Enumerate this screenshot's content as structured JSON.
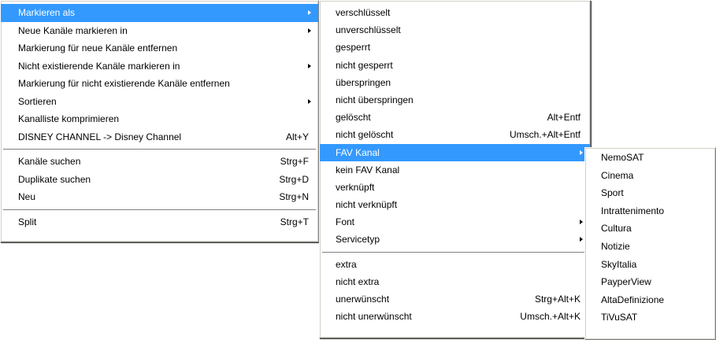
{
  "menu1": {
    "items": [
      {
        "label": "Markieren als",
        "shortcut": "",
        "submenu": true,
        "highlighted": true
      },
      {
        "label": "Neue Kanäle markieren in",
        "shortcut": "",
        "submenu": true
      },
      {
        "label": "Markierung für neue Kanäle entfernen",
        "shortcut": ""
      },
      {
        "label": "Nicht existierende Kanäle markieren in",
        "shortcut": "",
        "submenu": true
      },
      {
        "label": "Markierung für nicht existierende Kanäle entfernen",
        "shortcut": ""
      },
      {
        "label": "Sortieren",
        "shortcut": "",
        "submenu": true
      },
      {
        "label": "Kanalliste komprimieren",
        "shortcut": ""
      },
      {
        "label": "DISNEY CHANNEL -> Disney Channel",
        "shortcut": "Alt+Y"
      },
      {
        "separator": true
      },
      {
        "label": "Kanäle suchen",
        "shortcut": "Strg+F"
      },
      {
        "label": "Duplikate suchen",
        "shortcut": "Strg+D"
      },
      {
        "label": "Neu",
        "shortcut": "Strg+N"
      },
      {
        "separator": true
      },
      {
        "label": "Split",
        "shortcut": "Strg+T"
      }
    ]
  },
  "menu2": {
    "items": [
      {
        "label": "verschlüsselt",
        "shortcut": ""
      },
      {
        "label": "unverschlüsselt",
        "shortcut": ""
      },
      {
        "label": "gesperrt",
        "shortcut": ""
      },
      {
        "label": "nicht gesperrt",
        "shortcut": ""
      },
      {
        "label": "überspringen",
        "shortcut": ""
      },
      {
        "label": "nicht überspringen",
        "shortcut": ""
      },
      {
        "label": "gelöscht",
        "shortcut": "Alt+Entf"
      },
      {
        "label": "nicht gelöscht",
        "shortcut": "Umsch.+Alt+Entf"
      },
      {
        "label": "FAV Kanal",
        "shortcut": "",
        "submenu": true,
        "highlighted": true
      },
      {
        "label": "kein FAV Kanal",
        "shortcut": ""
      },
      {
        "label": "verknüpft",
        "shortcut": ""
      },
      {
        "label": "nicht verknüpft",
        "shortcut": ""
      },
      {
        "label": "Font",
        "shortcut": "",
        "submenu": true
      },
      {
        "label": "Servicetyp",
        "shortcut": "",
        "submenu": true
      },
      {
        "separator": true
      },
      {
        "label": "extra",
        "shortcut": ""
      },
      {
        "label": "nicht extra",
        "shortcut": ""
      },
      {
        "label": "unerwünscht",
        "shortcut": "Strg+Alt+K"
      },
      {
        "label": "nicht unerwünscht",
        "shortcut": "Umsch.+Alt+K"
      }
    ]
  },
  "menu3": {
    "items": [
      {
        "label": "NemoSAT"
      },
      {
        "label": "Cinema"
      },
      {
        "label": "Sport"
      },
      {
        "label": "Intrattenimento"
      },
      {
        "label": "Cultura"
      },
      {
        "label": "Notizie"
      },
      {
        "label": "SkyItalia"
      },
      {
        "label": "PayperView"
      },
      {
        "label": "AltaDefinizione"
      },
      {
        "label": "TiVuSAT"
      }
    ]
  },
  "colors": {
    "highlight": "#3399ff",
    "menu_bg": "#ffffff"
  }
}
